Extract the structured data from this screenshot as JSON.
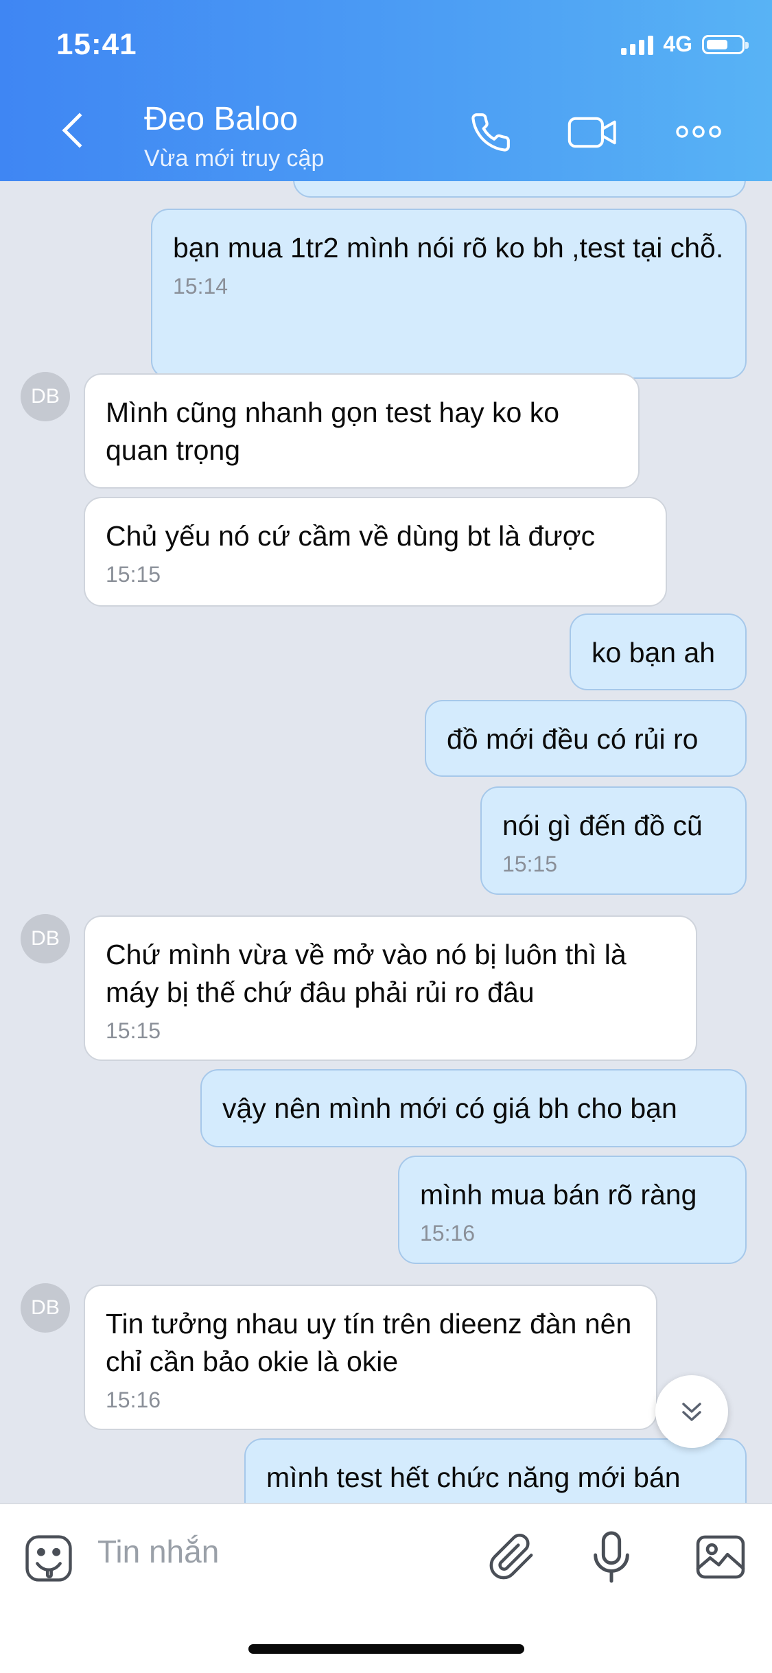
{
  "status_bar": {
    "time": "15:41",
    "network": "4G"
  },
  "header": {
    "contact_name": "Đeo Baloo",
    "status": "Vừa mới truy cập"
  },
  "avatar_initials": "DB",
  "messages": [
    {
      "dir": "out",
      "text": "bạn mua 1tr2 mình nói rõ ko bh ,test tại chỗ.",
      "time": "15:14"
    },
    {
      "dir": "in",
      "text": "Mình cũng nhanh gọn test hay ko ko quan trọng",
      "time": ""
    },
    {
      "dir": "in",
      "text": "Chủ yếu nó cứ cầm về dùng bt là được",
      "time": "15:15"
    },
    {
      "dir": "out",
      "text": "ko bạn ah",
      "time": ""
    },
    {
      "dir": "out",
      "text": "đồ mới đều có rủi ro",
      "time": ""
    },
    {
      "dir": "out",
      "text": "nói gì đến đồ cũ",
      "time": "15:15"
    },
    {
      "dir": "in",
      "text": "Chứ mình vừa về mở vào nó bị luôn thì là máy bị thế chứ đâu phải rủi ro đâu",
      "time": "15:15"
    },
    {
      "dir": "out",
      "text": "vậy nên mình mới có giá bh cho bạn",
      "time": ""
    },
    {
      "dir": "out",
      "text": "mình mua bán rõ ràng",
      "time": "15:16"
    },
    {
      "dir": "in",
      "text": "Tin tưởng nhau uy tín trên dieenz đàn nên chỉ cần bảo okie là okie",
      "time": "15:16"
    },
    {
      "dir": "out",
      "text": "mình test hết chức năng mới bán",
      "time": ""
    }
  ],
  "input": {
    "placeholder": "Tin nhắn"
  },
  "icons": [
    "back-icon",
    "phone-icon",
    "video-call-icon",
    "more-icon",
    "sticker-icon",
    "attachment-icon",
    "microphone-icon",
    "image-icon",
    "scroll-down-icon"
  ],
  "colors": {
    "header_start": "#3f86f3",
    "header_end": "#58b3f5",
    "outgoing_bubble": "#d4ebfd",
    "incoming_bubble": "#ffffff",
    "chat_bg": "#e2e6ee"
  }
}
